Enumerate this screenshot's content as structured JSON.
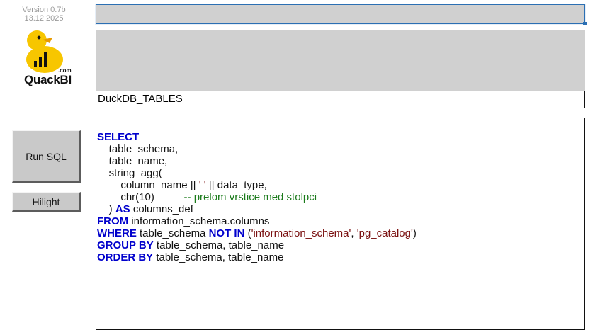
{
  "sidebar": {
    "version": "Version 0.7b",
    "date": "13.12.2025",
    "logo": {
      "name": "QuackBI",
      "suffix": ".com"
    },
    "run_label": "Run SQL",
    "hilight_label": "Hilight"
  },
  "main": {
    "top_input_value": "",
    "table_name": "DuckDB_TABLES"
  },
  "editor": {
    "lines": [
      [
        {
          "t": "SELECT",
          "c": "kw"
        }
      ],
      [
        {
          "t": "    table_schema,",
          "c": ""
        }
      ],
      [
        {
          "t": "    table_name,",
          "c": ""
        }
      ],
      [
        {
          "t": "    string_agg(",
          "c": ""
        }
      ],
      [
        {
          "t": "        column_name || ",
          "c": ""
        },
        {
          "t": "' '",
          "c": "str"
        },
        {
          "t": " || data_type,",
          "c": ""
        }
      ],
      [
        {
          "t": "        chr(10)          ",
          "c": ""
        },
        {
          "t": "-- prelom vrstice med stolpci",
          "c": "cmt"
        }
      ],
      [
        {
          "t": "    ) ",
          "c": ""
        },
        {
          "t": "AS",
          "c": "kw"
        },
        {
          "t": " columns_def",
          "c": ""
        }
      ],
      [
        {
          "t": "FROM",
          "c": "kw"
        },
        {
          "t": " information_schema.columns",
          "c": ""
        }
      ],
      [
        {
          "t": "WHERE",
          "c": "kw"
        },
        {
          "t": " table_schema ",
          "c": ""
        },
        {
          "t": "NOT IN",
          "c": "kw"
        },
        {
          "t": " (",
          "c": ""
        },
        {
          "t": "'information_schema'",
          "c": "str"
        },
        {
          "t": ", ",
          "c": ""
        },
        {
          "t": "'pg_catalog'",
          "c": "str"
        },
        {
          "t": ")",
          "c": ""
        }
      ],
      [
        {
          "t": "GROUP BY",
          "c": "kw"
        },
        {
          "t": " table_schema, table_name",
          "c": ""
        }
      ],
      [
        {
          "t": "ORDER BY",
          "c": "kw"
        },
        {
          "t": " table_schema, table_name",
          "c": ""
        }
      ]
    ]
  },
  "colors": {
    "keyword": "#0000cc",
    "string": "#7a1010",
    "comment": "#1a7a1a",
    "logo_yellow": "#f7c600"
  }
}
